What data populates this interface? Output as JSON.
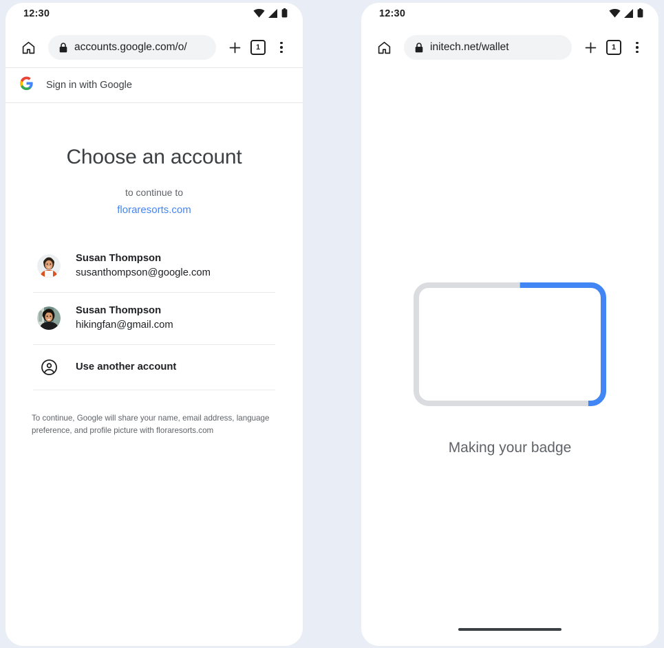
{
  "background_color": "#e9edf6",
  "phones": {
    "left": {
      "status_bar": {
        "time": "12:30",
        "icons": [
          "wifi-icon",
          "signal-icon",
          "battery-icon"
        ]
      },
      "toolbar": {
        "home_icon": "home-icon",
        "lock_icon": "lock-icon",
        "url": "accounts.google.com/o/",
        "new_tab_icon": "plus-icon",
        "tab_count": "1",
        "menu_icon": "kebab-menu-icon"
      },
      "gsi_header": {
        "logo": "google-g-icon",
        "label": "Sign in with Google"
      },
      "chooser": {
        "title": "Choose an account",
        "continue_to": "to continue to",
        "host": "floraresorts.com",
        "host_color": "#4285f4",
        "accounts": [
          {
            "name": "Susan Thompson",
            "email": "susanthompson@google.com",
            "avatar": "avatar-susan-google"
          },
          {
            "name": "Susan Thompson",
            "email": "hikingfan@gmail.com",
            "avatar": "avatar-susan-gmail"
          }
        ],
        "use_another": {
          "icon": "account-circle-icon",
          "label": "Use another account"
        },
        "disclaimer": "To continue, Google will share your name, email address, language preference, and profile picture with floraresorts.com"
      }
    },
    "right": {
      "status_bar": {
        "time": "12:30",
        "icons": [
          "wifi-icon",
          "signal-icon",
          "battery-icon"
        ]
      },
      "toolbar": {
        "home_icon": "home-icon",
        "lock_icon": "lock-icon",
        "url": "initech.net/wallet",
        "new_tab_icon": "plus-icon",
        "tab_count": "1",
        "menu_icon": "kebab-menu-icon"
      },
      "loading": {
        "label": "Making your badge",
        "track_color": "#dadce0",
        "progress_color": "#4285f4",
        "progress_percent": 35
      },
      "gesture_bar": "home-indicator"
    }
  }
}
